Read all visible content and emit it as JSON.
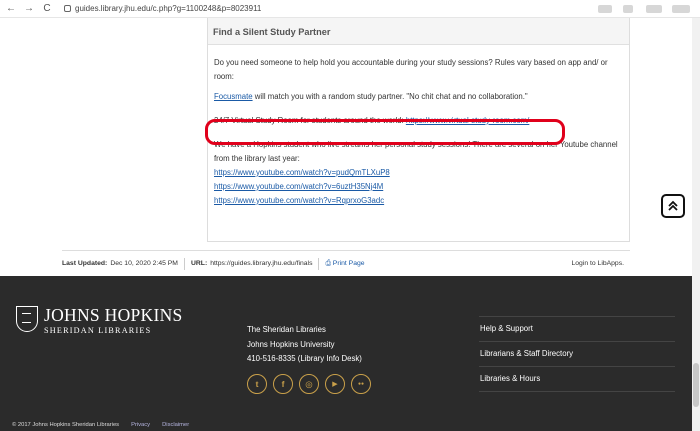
{
  "browser": {
    "url": "guides.library.jhu.edu/c.php?g=1100248&p=8023911",
    "back_icon": "←",
    "forward_icon": "→",
    "reload_icon": "C"
  },
  "box": {
    "title": "Find a Silent Study Partner",
    "intro": "Do you need someone to help hold you accountable during your study sessions? Rules vary based on app and/ or room:",
    "focusmate_link": "Focusmate",
    "focusmate_text": " will match you with a random study partner. \"No chit chat and no collaboration.\"",
    "room_text": "24/7 Virtual Study Room for students around the world: ",
    "room_link": "https://www.virtual-study-room.com/",
    "hopkins_text": "We have a Hopkins student who live streams her personal study sessions! There are several on her Youtube channel from the library last year:",
    "youtube_links": [
      "https://www.youtube.com/watch?v=pudQmTLXuP8",
      "https://www.youtube.com/watch?v=6uztH35Nj4M",
      "https://www.youtube.com/watch?v=RqprxoG3adc"
    ]
  },
  "back_to_top_icon": "chevrons-up",
  "meta": {
    "updated_label": "Last Updated:",
    "updated_value": "Dec 10, 2020 2:45 PM",
    "url_label": "URL:",
    "url_value": "https://guides.library.jhu.edu/finals",
    "print_label": "Print Page",
    "login_label": "Login to LibApps."
  },
  "footer": {
    "logo_line1": "JOHNS HOPKINS",
    "logo_line2": "SHERIDAN LIBRARIES",
    "address_line1": "The Sheridan Libraries",
    "address_line2": "Johns Hopkins University",
    "address_line3": "410-516-8335 (Library Info Desk)",
    "social": [
      {
        "icon": "twitter-icon",
        "glyph": "t"
      },
      {
        "icon": "facebook-icon",
        "glyph": "f"
      },
      {
        "icon": "instagram-icon",
        "glyph": "◎"
      },
      {
        "icon": "youtube-icon",
        "glyph": "▶"
      },
      {
        "icon": "flickr-icon",
        "glyph": "●●"
      }
    ],
    "links": [
      "Help & Support",
      "Librarians & Staff Directory",
      "Libraries & Hours"
    ],
    "copyright": "© 2017 Johns Hopkins Sheridan Libraries",
    "privacy": "Privacy",
    "disclaimer": "Disclaimer"
  },
  "colors": {
    "accent_link": "#1a5aa6",
    "highlight": "#e0001b",
    "footer_bg": "#2b2b2b",
    "social_gold": "#c9a04a"
  }
}
